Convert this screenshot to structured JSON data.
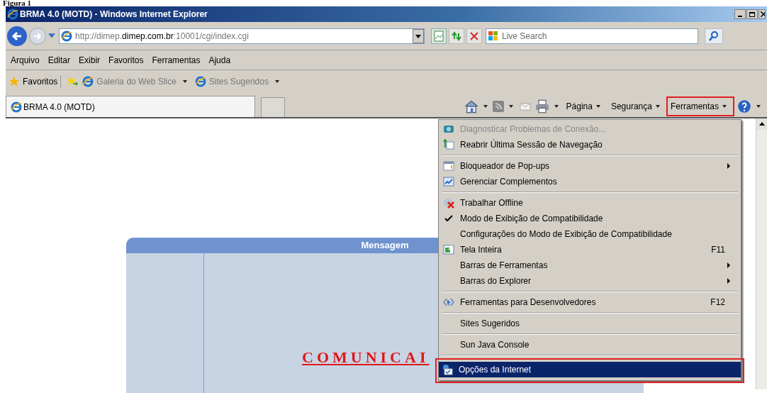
{
  "caption": "Figura 1",
  "window": {
    "title": "BRMA 4.0 (MOTD) - Windows Internet Explorer"
  },
  "address_bar": {
    "url_prefix": "http://dimep.",
    "url_domain": "dimep.com.br",
    "url_suffix": ":10001/cgi/index.cgi"
  },
  "search": {
    "placeholder": "Live Search"
  },
  "menu_bar": [
    "Arquivo",
    "Editar",
    "Exibir",
    "Favoritos",
    "Ferramentas",
    "Ajuda"
  ],
  "favorites_bar": {
    "favorites": "Favoritos",
    "links": [
      "Galeria do Web Slice",
      "Sites Sugeridos"
    ]
  },
  "tabs": [
    {
      "label": "BRMA 4.0 (MOTD)",
      "selected": true
    }
  ],
  "command_bar": [
    {
      "label": "Página",
      "highlighted": false
    },
    {
      "label": "Segurança",
      "highlighted": false
    },
    {
      "label": "Ferramentas",
      "highlighted": true
    }
  ],
  "tools_menu": [
    {
      "kind": "item",
      "label": "Diagnosticar Problemas de Conexão...",
      "disabled": true,
      "checked": false,
      "selected": false
    },
    {
      "kind": "item",
      "label": "Reabrir Última Sessão de Navegação",
      "disabled": false,
      "checked": false,
      "selected": false
    },
    {
      "kind": "separator"
    },
    {
      "kind": "item",
      "label": "Bloqueador de Pop-ups",
      "disabled": false,
      "checked": false,
      "submenu": true,
      "selected": false
    },
    {
      "kind": "item",
      "label": "Gerenciar Complementos",
      "disabled": false,
      "checked": false,
      "selected": false
    },
    {
      "kind": "separator"
    },
    {
      "kind": "item",
      "label": "Trabalhar Offline",
      "disabled": false,
      "checked": false,
      "selected": false
    },
    {
      "kind": "item",
      "label": "Modo de Exibição de Compatibilidade",
      "disabled": false,
      "checked": true,
      "selected": false
    },
    {
      "kind": "item",
      "label": "Configurações do Modo de Exibição de Compatibilidade",
      "disabled": false,
      "checked": false,
      "selected": false
    },
    {
      "kind": "item",
      "label": "Tela Inteira",
      "shortcut": "F11",
      "disabled": false,
      "checked": false,
      "selected": false
    },
    {
      "kind": "item",
      "label": "Barras de Ferramentas",
      "disabled": false,
      "checked": false,
      "submenu": true,
      "selected": false
    },
    {
      "kind": "item",
      "label": "Barras do Explorer",
      "disabled": false,
      "checked": false,
      "submenu": true,
      "selected": false
    },
    {
      "kind": "separator"
    },
    {
      "kind": "item",
      "label": "Ferramentas para Desenvolvedores",
      "shortcut": "F12",
      "disabled": false,
      "checked": false,
      "selected": false
    },
    {
      "kind": "separator"
    },
    {
      "kind": "item",
      "label": "Sites Sugeridos",
      "disabled": false,
      "checked": false,
      "selected": false
    },
    {
      "kind": "separator"
    },
    {
      "kind": "item",
      "label": "Sun Java Console",
      "disabled": false,
      "checked": false,
      "selected": false
    },
    {
      "kind": "separator"
    },
    {
      "kind": "item",
      "label": "Opções da Internet",
      "disabled": false,
      "checked": false,
      "selected": true,
      "highlighted": true
    }
  ],
  "page": {
    "panel_title": "Mensagem",
    "headline": "COMUNICAI"
  }
}
